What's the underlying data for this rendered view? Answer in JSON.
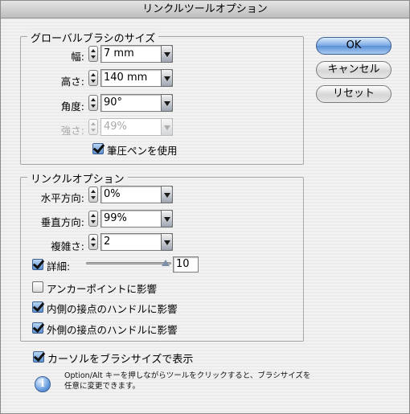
{
  "window": {
    "title": "リンクルツールオプション"
  },
  "brush_group": {
    "legend": "グローバルブラシのサイズ",
    "width": {
      "label": "幅:",
      "value": "7 mm"
    },
    "height": {
      "label": "高さ:",
      "value": "140 mm"
    },
    "angle": {
      "label": "角度:",
      "value": "90°"
    },
    "intensity": {
      "label": "強さ:",
      "value": "49%"
    },
    "use_pressure": {
      "label": "筆圧ペンを使用",
      "checked": true
    }
  },
  "wrinkle_group": {
    "legend": "リンクルオプション",
    "horizontal": {
      "label": "水平方向:",
      "value": "0%"
    },
    "vertical": {
      "label": "垂直方向:",
      "value": "99%"
    },
    "complexity": {
      "label": "複雑さ:",
      "value": "2"
    },
    "detail": {
      "label": "詳細:",
      "value": "10",
      "checked": true,
      "slider_level": 1.0
    },
    "anchor_points": {
      "label": "アンカーポイントに影響",
      "checked": false
    },
    "in_tangent": {
      "label": "内側の接点のハンドルに影響",
      "checked": true
    },
    "out_tangent": {
      "label": "外側の接点のハンドルに影響",
      "checked": true
    }
  },
  "show_brush_size": {
    "label": "カーソルをブラシサイズで表示",
    "checked": true
  },
  "info_note": {
    "line1": "Option/Alt キーを押しながらツールをクリックすると、ブラシサイズを",
    "line2": "任意に変更できます。",
    "icon": "info-icon"
  },
  "buttons": {
    "ok": "OK",
    "cancel": "キャンセル",
    "reset": "リセット"
  }
}
